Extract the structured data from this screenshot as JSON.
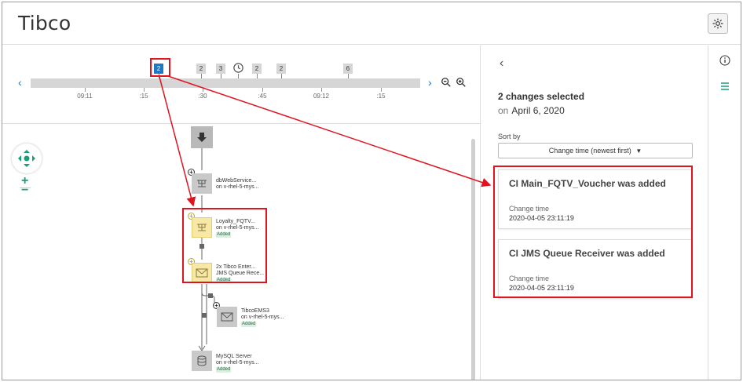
{
  "app": {
    "title": "Tibco"
  },
  "timeline": {
    "ticks": [
      "09:11",
      ":15",
      ":30",
      ":45",
      "09:12",
      ":15"
    ],
    "markers": [
      "2",
      "2",
      "3",
      "2",
      "2",
      "6"
    ],
    "selected_marker": "2"
  },
  "graph": {
    "nodes": [
      {
        "name": "dbWebService...",
        "sub": "on v-rhel-5-mys...",
        "badge": ""
      },
      {
        "name": "Loyalty_FQTV...",
        "sub": "on v-rhel-5-mys...",
        "badge": "Added"
      },
      {
        "name": "2x Tibco Enter...",
        "sub": "JMS Queue Rece...",
        "badge": "Added"
      },
      {
        "name": "TibcoEMS3",
        "sub": "on v-rhel-5-mys...",
        "badge": "Added"
      },
      {
        "name": "MySQL Server",
        "sub": "on v-rhel-5-mys...",
        "badge": "Added"
      }
    ]
  },
  "details": {
    "title": "2 changes selected",
    "date_prefix": "on",
    "date": "April 6, 2020",
    "sort_label": "Sort by",
    "sort_value": "Change time (newest first)",
    "cards": [
      {
        "title": "CI Main_FQTV_Voucher was added",
        "label": "Change time",
        "value": "2020-04-05 23:11:19"
      },
      {
        "title": "CI JMS Queue Receiver was added",
        "label": "Change time",
        "value": "2020-04-05 23:11:19"
      }
    ]
  },
  "colors": {
    "accent": "#1f78c1",
    "highlight": "#e0141e",
    "added_fill": "#f7e8a6",
    "teal": "#1a9e7a"
  },
  "icons": [
    "settings-gear-icon",
    "info-icon",
    "list-icon",
    "clock-icon",
    "zoom-out-icon",
    "zoom-in-icon",
    "chevron-left-icon",
    "chevron-right-icon",
    "navigation-pad-icon"
  ]
}
